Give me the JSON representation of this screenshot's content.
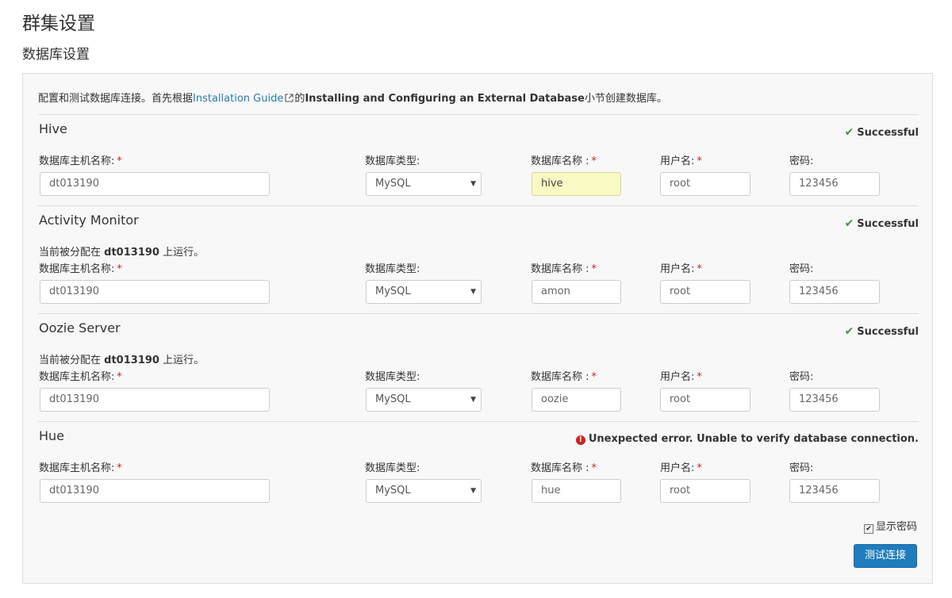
{
  "page": {
    "title": "群集设置",
    "subtitle": "数据库设置"
  },
  "intro": {
    "text_before": "配置和测试数据库连接。首先根据",
    "link": "Installation Guide",
    "text_mid": "的",
    "bold": "Installing and Configuring an External Database",
    "text_after": "小节创建数据库。"
  },
  "labels": {
    "host": "数据库主机名称:",
    "type": "数据库类型:",
    "dbname": "数据库名称 :",
    "user": "用户名:",
    "password": "密码:",
    "required": "*"
  },
  "assign": {
    "prefix": "当前被分配在",
    "host": "dt013190",
    "suffix": "上运行。"
  },
  "sections": [
    {
      "title": "Hive",
      "status": "Successful",
      "host": "dt013190",
      "type": "MySQL",
      "dbname": "hive",
      "user": "root",
      "password": "123456"
    },
    {
      "title": "Activity Monitor",
      "status": "Successful",
      "host": "dt013190",
      "type": "MySQL",
      "dbname": "amon",
      "user": "root",
      "password": "123456"
    },
    {
      "title": "Oozie Server",
      "status": "Successful",
      "host": "dt013190",
      "type": "MySQL",
      "dbname": "oozie",
      "user": "root",
      "password": "123456"
    },
    {
      "title": "Hue",
      "status": "Unexpected error. Unable to verify database connection.",
      "host": "dt013190",
      "type": "MySQL",
      "dbname": "hue",
      "user": "root",
      "password": "123456"
    }
  ],
  "show_password": {
    "label": "显示密码",
    "checked": true
  },
  "test_button": "测试连接",
  "colors": {
    "link": "#2a7ab0",
    "success": "#3c9a3c",
    "error": "#cc2222",
    "required": "#cc2222",
    "button": "#1f7cbd",
    "highlight_field": "#f9f9c4"
  }
}
